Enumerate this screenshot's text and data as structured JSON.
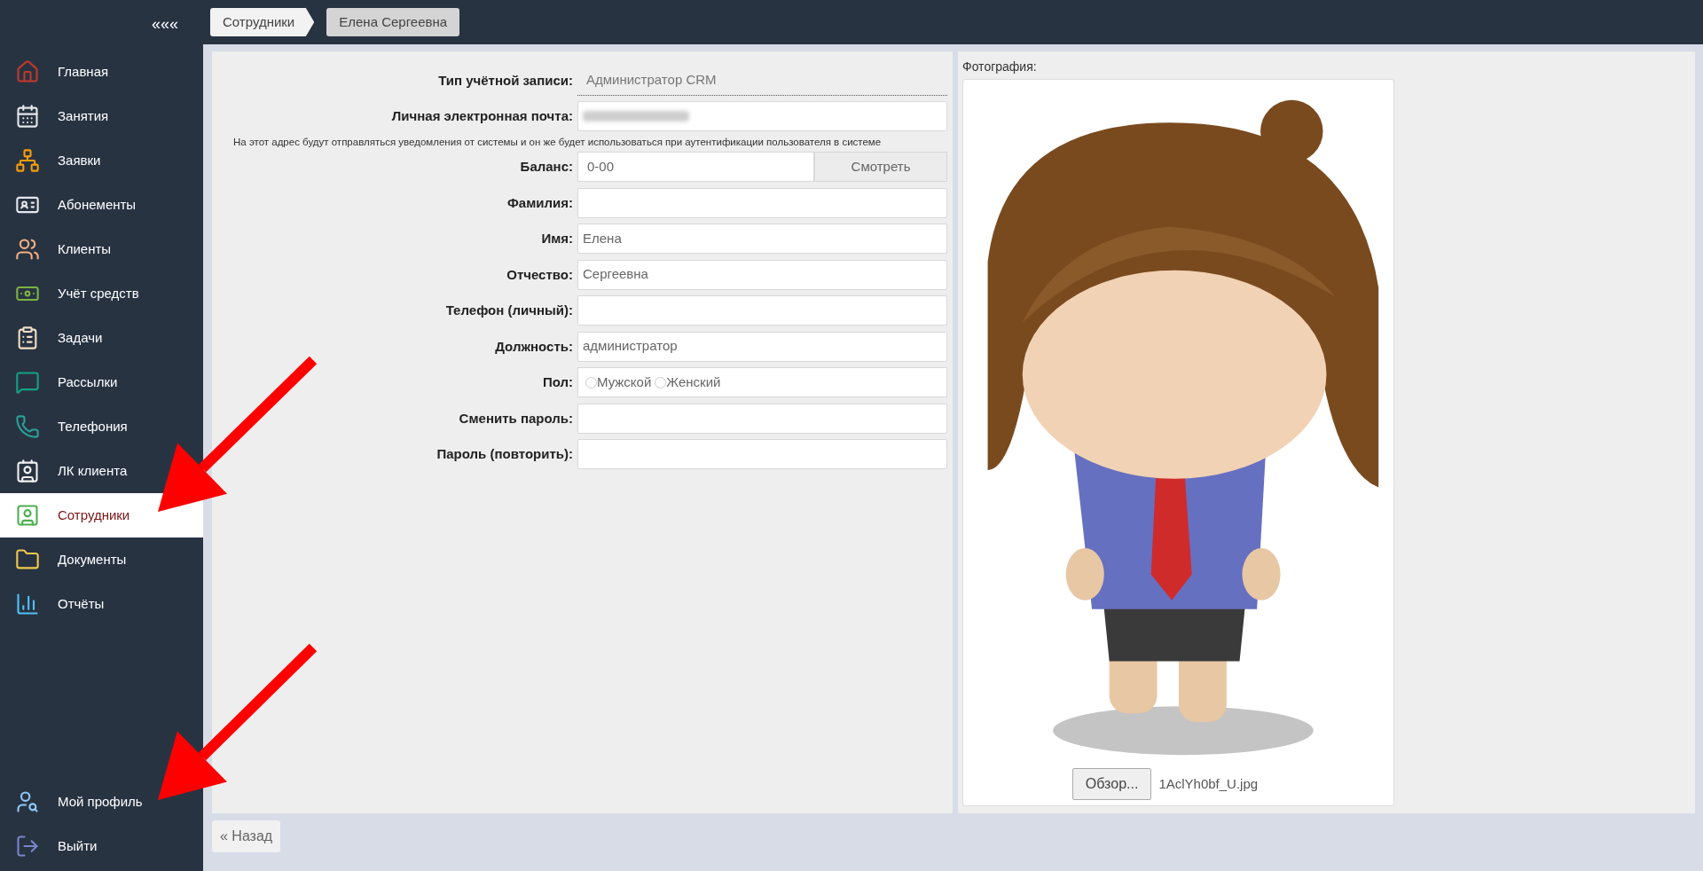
{
  "sidebar": {
    "collapse": "«««",
    "items": [
      {
        "label": "Главная",
        "selected": false
      },
      {
        "label": "Занятия",
        "selected": false
      },
      {
        "label": "Заявки",
        "selected": false
      },
      {
        "label": "Абонементы",
        "selected": false
      },
      {
        "label": "Клиенты",
        "selected": false
      },
      {
        "label": "Учёт средств",
        "selected": false
      },
      {
        "label": "Задачи",
        "selected": false
      },
      {
        "label": "Рассылки",
        "selected": false
      },
      {
        "label": "Телефония",
        "selected": false
      },
      {
        "label": "ЛК клиента",
        "selected": false
      },
      {
        "label": "Сотрудники",
        "selected": true
      },
      {
        "label": "Документы",
        "selected": false
      },
      {
        "label": "Отчёты",
        "selected": false
      }
    ],
    "bottom_items": [
      {
        "label": "Мой профиль",
        "selected": false
      },
      {
        "label": "Выйти",
        "selected": false
      }
    ]
  },
  "breadcrumbs": [
    {
      "label": "Сотрудники",
      "selected": false
    },
    {
      "label": "Елена Сергеевна",
      "selected": true
    }
  ],
  "form": {
    "rows": [
      {
        "kind": "static",
        "label": "Тип учётной записи:",
        "value": "Администратор CRM"
      },
      {
        "kind": "blurred",
        "label": "Личная электронная почта:"
      },
      {
        "kind": "hint",
        "text": "На этот адрес будут отправляться уведомления от системы и он же будет использоваться при аутентификации пользователя в системе"
      },
      {
        "kind": "button",
        "label": "Баланс:",
        "value": "0-00",
        "button": "Смотреть"
      },
      {
        "kind": "text",
        "label": "Фамилия:"
      },
      {
        "kind": "text",
        "label": "Имя:",
        "value": "Елена"
      },
      {
        "kind": "text",
        "label": "Отчество:",
        "value": "Сергеевна"
      },
      {
        "kind": "text",
        "label": "Телефон (личный):"
      },
      {
        "kind": "text",
        "label": "Должность:",
        "value": "администратор"
      },
      {
        "kind": "radio",
        "label": "Пол:",
        "options": [
          {
            "label": "Мужской",
            "selected": false
          },
          {
            "label": "Женский",
            "selected": false
          }
        ]
      },
      {
        "kind": "password",
        "label": "Сменить пароль:"
      },
      {
        "kind": "password",
        "label": "Пароль (повторить):"
      }
    ]
  },
  "photo": {
    "label": "Фотография:",
    "browse_button": "Обзор...",
    "file_name": "1AclYh0bf_U.jpg"
  },
  "back_button": "« Назад"
}
